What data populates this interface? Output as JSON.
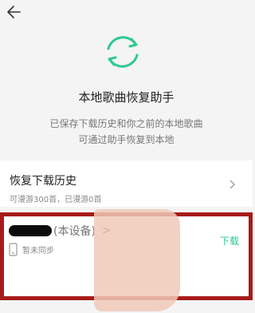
{
  "header": {
    "back_icon": "arrow-left-icon"
  },
  "hero": {
    "icon": "sync-icon",
    "accent": "#2ec98f",
    "title": "本地歌曲恢复助手",
    "desc_line1": "已保存下载历史和你之前的本地歌曲",
    "desc_line2": "可通过助手恢复到本地"
  },
  "history": {
    "title": "恢复下载历史",
    "subtitle": "可漫游300首，已漫游0首"
  },
  "device": {
    "name_suffix": "(本设备)",
    "arrow": ">",
    "sync_status": "暂未同步",
    "download_label": "下载"
  }
}
